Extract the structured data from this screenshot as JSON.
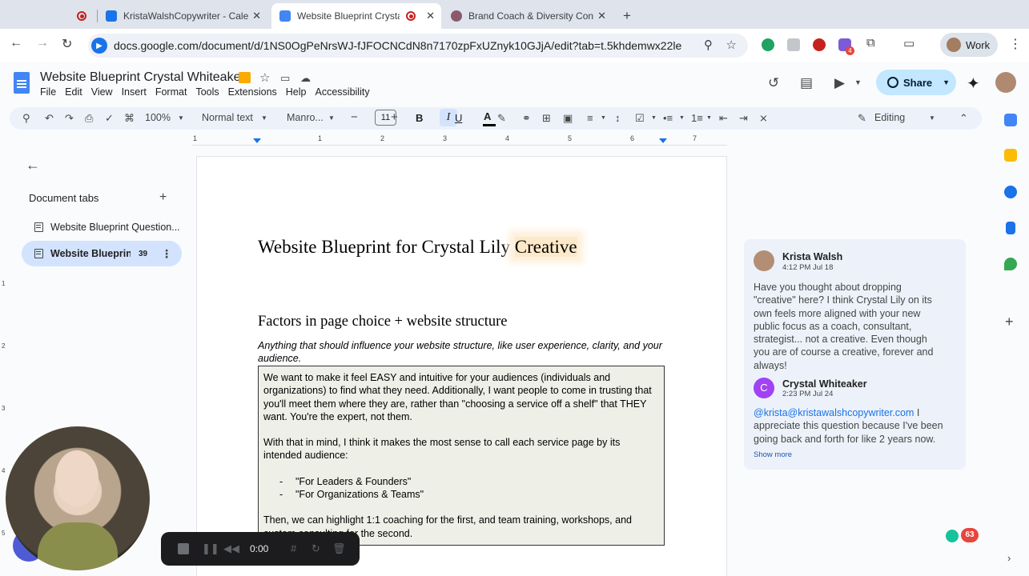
{
  "browser": {
    "tabs": [
      {
        "title": "",
        "icon": "record-icon"
      },
      {
        "title": "KristaWalshCopywriter - Cale",
        "icon": "calendar-icon"
      },
      {
        "title": "Website Blueprint Crystal",
        "icon": "docs-icon",
        "active": true
      },
      {
        "title": "Brand Coach & Diversity Con",
        "icon": "site-icon"
      }
    ],
    "new_tab": "+",
    "url": "docs.google.com/document/d/1NS0OgPeNrsWJ-fJFOCNCdN8n7170zpFxUZnyk10GJjA/edit?tab=t.5khdemwx22le",
    "profile_label": "Work",
    "ext_badge": "4"
  },
  "doc": {
    "title": "Website Blueprint Crystal Whiteaker",
    "menus": [
      "File",
      "Edit",
      "View",
      "Insert",
      "Format",
      "Tools",
      "Extensions",
      "Help",
      "Accessibility"
    ],
    "share_label": "Share"
  },
  "toolbar": {
    "zoom": "100%",
    "style": "Normal text",
    "font": "Manro...",
    "font_size": "11",
    "bold": "B",
    "italic": "I",
    "underline": "U",
    "text_color": "A",
    "mode": "Editing"
  },
  "ruler": {
    "labels": [
      "1",
      "1",
      "2",
      "3",
      "4",
      "5",
      "6",
      "7"
    ],
    "vlabels": [
      "1",
      "2",
      "3",
      "4",
      "5"
    ]
  },
  "sidebar": {
    "heading": "Document tabs",
    "add": "+",
    "tabs": [
      {
        "label": "Website Blueprint Question...",
        "count": ""
      },
      {
        "label": "Website Blueprin...",
        "count": "39"
      }
    ]
  },
  "page": {
    "heading_main": "Website Blueprint for Crystal Lily",
    "heading_highlight": "Creative",
    "subheading": "Factors in page choice + website structure",
    "intro": "Anything that should influence your website structure, like user experience, clarity, and your audience.",
    "answer": {
      "p1": "We want to make it feel EASY and intuitive for your audiences (individuals and organizations) to find what they need. Additionally, I want people to come in trusting that you'll meet them where they are, rather than \"choosing a service off a shelf\"  that THEY want.  You're the expert, not them.",
      "p2": "With that in mind, I think it makes the most sense to call each service page by its intended audience:",
      "items": [
        "\"For Leaders & Founders\"",
        "\"For Organizations & Teams\""
      ],
      "p3": "Then, we can highlight 1:1 coaching for the first, and team training, workshops, and custom consulting for the second."
    }
  },
  "comment": {
    "first": {
      "name": "Krista Walsh",
      "time": "4:12 PM Jul 18",
      "body": "Have you thought about dropping \"creative\" here? I think Crystal Lily on its own feels more aligned with your new public focus as a coach, consultant, strategist... not a creative. Even though you are of course a creative, forever and always!"
    },
    "reply": {
      "initial": "C",
      "name": "Crystal Whiteaker",
      "time": "2:23 PM Jul 24",
      "mention": "@krista@kristawalshcopywriter.com",
      "body": " I appreciate this question because I've been going back and forth for like 2 years now."
    },
    "show_more": "Show more"
  },
  "recorder": {
    "time": "0:00"
  },
  "badge": "63"
}
